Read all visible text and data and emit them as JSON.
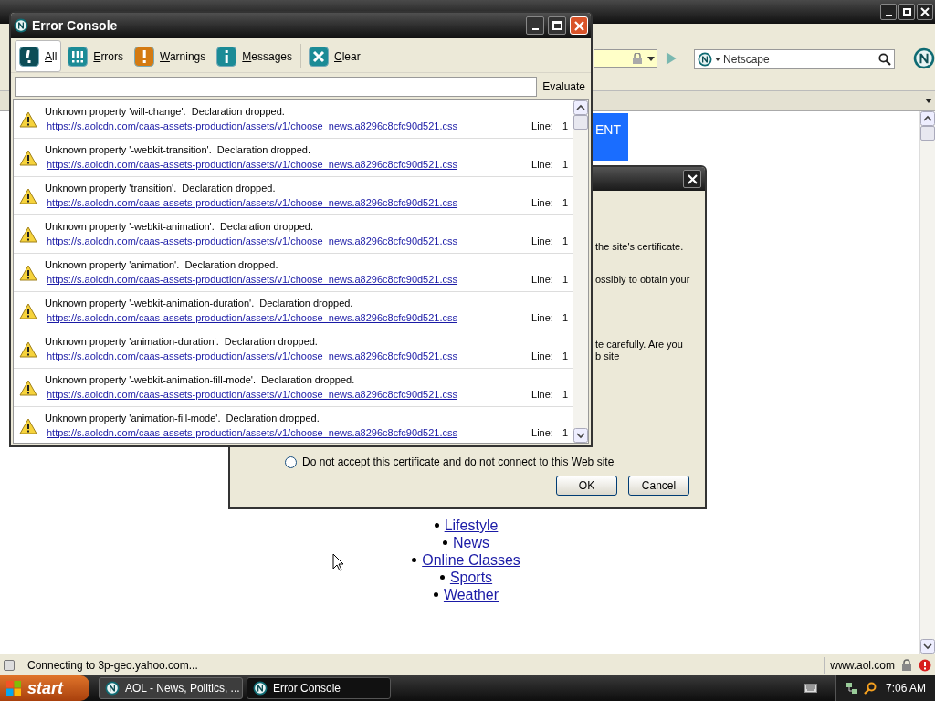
{
  "browser": {
    "search": {
      "value": "Netscape"
    },
    "content": {
      "banner": "ENT",
      "links": [
        "Lifestyle",
        "News",
        "Online Classes",
        "Sports",
        "Weather"
      ]
    },
    "status_bar": {
      "text": "Connecting to 3p-geo.yahoo.com...",
      "site": "www.aol.com"
    }
  },
  "certificate_dialog": {
    "lines": [
      "the site's certificate.",
      "ossibly to obtain your",
      "te carefully. Are you",
      "b site"
    ],
    "option": {
      "label": "Do not accept this certificate and do not connect to this Web site",
      "selected": false
    },
    "buttons": [
      "OK",
      "Cancel"
    ]
  },
  "error_console": {
    "title": "Error Console",
    "tabs": [
      {
        "label": "All",
        "selected": true,
        "kind": "all"
      },
      {
        "label": "Errors",
        "selected": false,
        "kind": "errors"
      },
      {
        "label": "Warnings",
        "selected": false,
        "kind": "warnings"
      },
      {
        "label": "Messages",
        "selected": false,
        "kind": "messages"
      }
    ],
    "clear": "Clear",
    "evaluate": "Evaluate",
    "entries": [
      {
        "message": "Unknown property 'will-change'.  Declaration dropped.",
        "url": "https://s.aolcdn.com/caas-assets-production/assets/v1/choose_news.a8296c8cfc90d521.css",
        "line_label": "Line:",
        "line": "1"
      },
      {
        "message": "Unknown property '-webkit-transition'.  Declaration dropped.",
        "url": "https://s.aolcdn.com/caas-assets-production/assets/v1/choose_news.a8296c8cfc90d521.css",
        "line_label": "Line:",
        "line": "1"
      },
      {
        "message": "Unknown property 'transition'.  Declaration dropped.",
        "url": "https://s.aolcdn.com/caas-assets-production/assets/v1/choose_news.a8296c8cfc90d521.css",
        "line_label": "Line:",
        "line": "1"
      },
      {
        "message": "Unknown property '-webkit-animation'.  Declaration dropped.",
        "url": "https://s.aolcdn.com/caas-assets-production/assets/v1/choose_news.a8296c8cfc90d521.css",
        "line_label": "Line:",
        "line": "1"
      },
      {
        "message": "Unknown property 'animation'.  Declaration dropped.",
        "url": "https://s.aolcdn.com/caas-assets-production/assets/v1/choose_news.a8296c8cfc90d521.css",
        "line_label": "Line:",
        "line": "1"
      },
      {
        "message": "Unknown property '-webkit-animation-duration'.  Declaration dropped.",
        "url": "https://s.aolcdn.com/caas-assets-production/assets/v1/choose_news.a8296c8cfc90d521.css",
        "line_label": "Line:",
        "line": "1"
      },
      {
        "message": "Unknown property 'animation-duration'.  Declaration dropped.",
        "url": "https://s.aolcdn.com/caas-assets-production/assets/v1/choose_news.a8296c8cfc90d521.css",
        "line_label": "Line:",
        "line": "1"
      },
      {
        "message": "Unknown property '-webkit-animation-fill-mode'.  Declaration dropped.",
        "url": "https://s.aolcdn.com/caas-assets-production/assets/v1/choose_news.a8296c8cfc90d521.css",
        "line_label": "Line:",
        "line": "1"
      },
      {
        "message": "Unknown property 'animation-fill-mode'.  Declaration dropped.",
        "url": "https://s.aolcdn.com/caas-assets-production/assets/v1/choose_news.a8296c8cfc90d521.css",
        "line_label": "Line:",
        "line": "1"
      }
    ]
  },
  "taskbar": {
    "start": "start",
    "tasks": [
      {
        "label": "AOL - News, Politics, ...",
        "selected": false
      },
      {
        "label": "Error Console",
        "selected": true
      }
    ],
    "clock": "7:06 AM"
  }
}
